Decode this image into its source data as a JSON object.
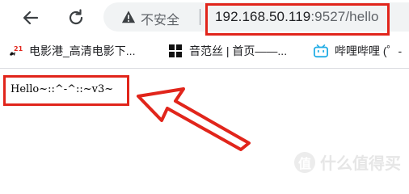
{
  "toolbar": {
    "insecure_label": "不安全",
    "url_host": "192.168.50.119",
    "url_rest": ":9527/hello"
  },
  "bookmarks": [
    {
      "label": "电影港_高清电影下...",
      "icon": "movie-site-icon"
    },
    {
      "label": "音范丝 | 首页——...",
      "icon": "grid-icon"
    },
    {
      "label": "哔哩哔哩 (゜-",
      "icon": "bilibili-icon"
    }
  ],
  "page": {
    "hello_text": "Hello~::^-^::~v3~"
  },
  "watermark": {
    "logo": "值",
    "text": "什么值得买"
  },
  "colors": {
    "highlight": "#e1251b",
    "bilibili": "#23ade5"
  }
}
